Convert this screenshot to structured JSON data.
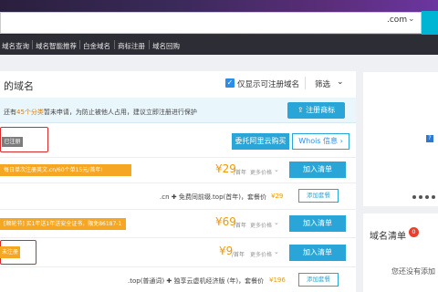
{
  "search": {
    "suffix": ".com",
    "suffix_arrow": "⌄"
  },
  "nav": {
    "items": [
      "域名查询",
      "域名智能推荐",
      "白金域名",
      "商标注册",
      "域名回购"
    ]
  },
  "panel": {
    "title": "的域名",
    "only_registrable_label": "仅显示可注册域名",
    "filter_label": "筛选",
    "filter_arrow": "⌄"
  },
  "notice": {
    "prefix": "还有",
    "highlight": "45个分类",
    "suffix": "暂未申请，为防止被他人占用，建议立即注册进行保护",
    "button_label": "注册商标"
  },
  "registered_row": {
    "status": "已注册",
    "entrust_label": "委托阿里云购买",
    "whois_label": "Whois 信息 ›"
  },
  "rows": [
    {
      "promo": "每日单次注册英文.cn/60个单15元/首年!",
      "price": "¥29",
      "per_year": "/首年",
      "more": "更多价格",
      "add_label": "加入清单"
    },
    {
      "combo": ".cn ✚ 免费同前缀.top(首年)，套餐价",
      "combo_price": "¥29",
      "add_combo_label": "添加套餐"
    },
    {
      "promo": "[顺轮节] 买1年送1年送安全证书，限免86187-1",
      "price": "¥69",
      "per_year": "/首年",
      "more": "更多价格",
      "add_label": "加入清单"
    },
    {
      "status": "未注册",
      "price": "¥9",
      "per_year": "/首年",
      "more": "更多价格",
      "add_label": "加入清单"
    },
    {
      "combo": ".top(普通词) ✚ 独享云虚机经济版 (年)，套餐价",
      "combo_price": "¥196",
      "add_combo_label": "添加套餐"
    }
  ],
  "ad": {
    "image_icon": "?"
  },
  "cart": {
    "title": "域名清单",
    "count": "0",
    "empty_text": "您还没有添加"
  },
  "colors": {
    "accent": "#29a6d7",
    "price": "#f39800",
    "promo": "#f5a623",
    "highlight_box": "#d92b2b"
  }
}
